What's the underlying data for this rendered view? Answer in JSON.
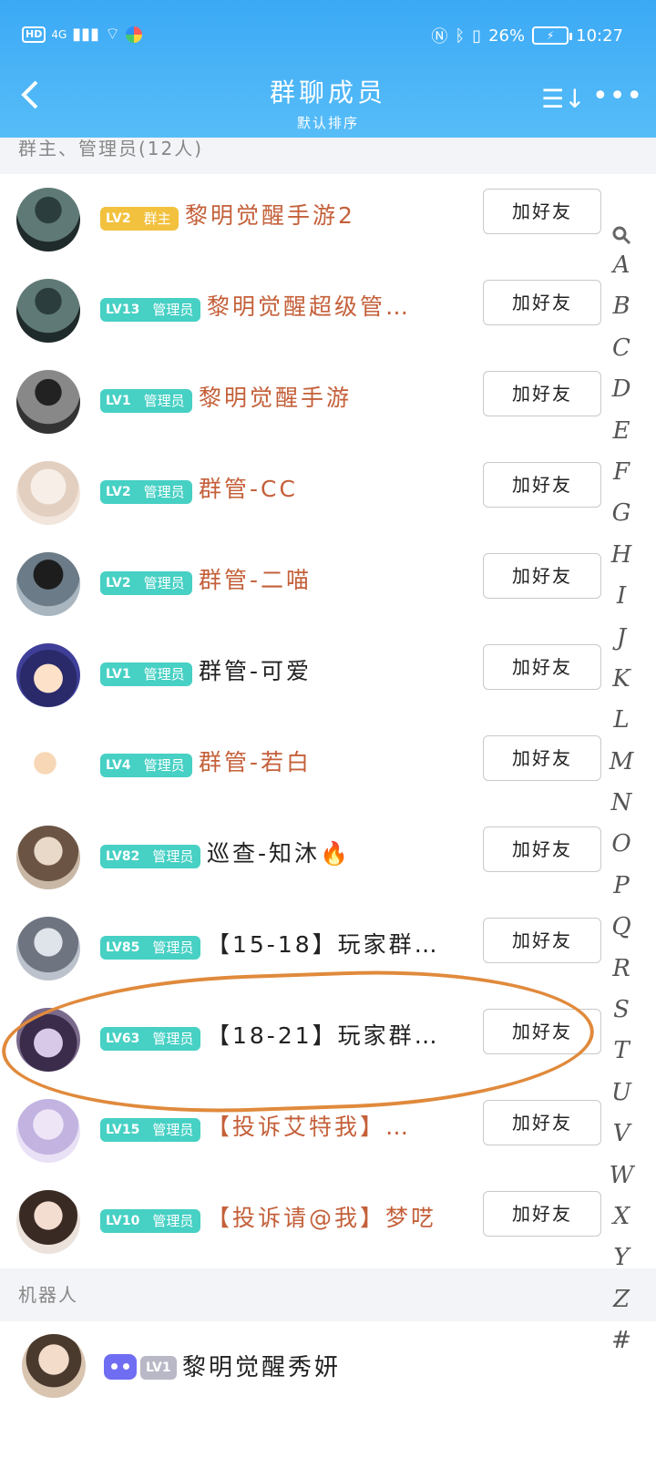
{
  "status": {
    "network": "4G",
    "hd": "HD",
    "battery_pct": "26%",
    "time": "10:27"
  },
  "header": {
    "title": "群聊成员",
    "subtitle": "默认排序"
  },
  "sections": {
    "admins_header": "群主、管理员(12人)",
    "bots_header": "机器人"
  },
  "add_friend_label": "加好友",
  "members": [
    {
      "level": "LV2",
      "role": "群主",
      "name": "黎明觉醒手游2",
      "type": "owner",
      "color": "#c4603a"
    },
    {
      "level": "LV13",
      "role": "管理员",
      "name": "黎明觉醒超级管…",
      "type": "admin",
      "color": "#c4603a"
    },
    {
      "level": "LV1",
      "role": "管理员",
      "name": "黎明觉醒手游",
      "type": "admin",
      "color": "#c4603a"
    },
    {
      "level": "LV2",
      "role": "管理员",
      "name": "群管-CC",
      "type": "admin",
      "color": "#c4603a"
    },
    {
      "level": "LV2",
      "role": "管理员",
      "name": "群管-二喵",
      "type": "admin",
      "color": "#c4603a"
    },
    {
      "level": "LV1",
      "role": "管理员",
      "name": "群管-可爱",
      "type": "admin",
      "color": "#222222"
    },
    {
      "level": "LV4",
      "role": "管理员",
      "name": "群管-若白",
      "type": "admin",
      "color": "#c4603a"
    },
    {
      "level": "LV82",
      "role": "管理员",
      "name": "巡查-知沐🔥",
      "type": "admin",
      "color": "#222222"
    },
    {
      "level": "LV85",
      "role": "管理员",
      "name": "【15-18】玩家群…",
      "type": "admin",
      "color": "#222222"
    },
    {
      "level": "LV63",
      "role": "管理员",
      "name": "【18-21】玩家群…",
      "type": "admin",
      "color": "#222222"
    },
    {
      "level": "LV15",
      "role": "管理员",
      "name": "【投诉艾特我】…",
      "type": "admin",
      "color": "#c4603a"
    },
    {
      "level": "LV10",
      "role": "管理员",
      "name": "【投诉请@我】梦呓",
      "type": "admin",
      "color": "#c4603a"
    }
  ],
  "bot": {
    "level": "LV1",
    "name": "黎明觉醒秀妍"
  },
  "index_letters": [
    "A",
    "B",
    "C",
    "D",
    "E",
    "F",
    "G",
    "H",
    "I",
    "J",
    "K",
    "L",
    "M",
    "N",
    "O",
    "P",
    "Q",
    "R",
    "S",
    "T",
    "U",
    "V",
    "W",
    "X",
    "Y",
    "Z",
    "#"
  ],
  "colors": {
    "header": "#3ba9f5",
    "admin_badge": "#47d0c4",
    "owner_badge": "#f2c13e",
    "name_orange": "#c4603a",
    "annotation": "#e08a3c"
  }
}
